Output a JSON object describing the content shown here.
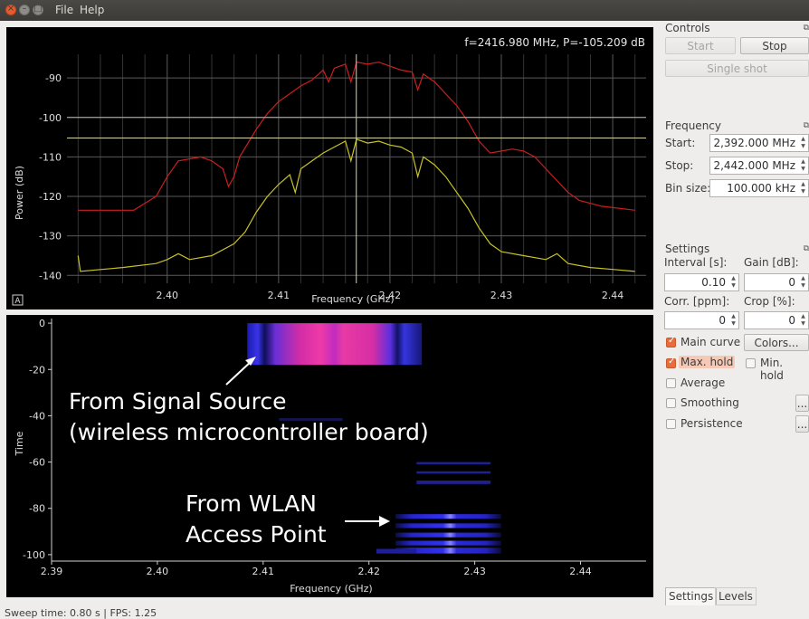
{
  "menu": {
    "file": "File",
    "help": "Help"
  },
  "spectrum": {
    "readout": "f=2416.980 MHz, P=-105.209 dB",
    "xlabel": "Frequency (GHz)",
    "ylabel": "Power (dB)",
    "x_ticks": [
      "2.40",
      "2.41",
      "2.42",
      "2.43",
      "2.44"
    ],
    "y_ticks": [
      "-90",
      "-100",
      "-110",
      "-120",
      "-130",
      "-140"
    ],
    "autoscale": "A"
  },
  "waterfall": {
    "xlabel": "Frequency (GHz)",
    "ylabel": "Time",
    "x_ticks": [
      "2.39",
      "2.40",
      "2.41",
      "2.42",
      "2.43",
      "2.44"
    ],
    "y_ticks": [
      "0",
      "-20",
      "-40",
      "-60",
      "-80",
      "-100"
    ],
    "annotation1": [
      "From Signal Source",
      "(wireless microcontroller board)"
    ],
    "annotation2": [
      "From WLAN",
      "Access Point"
    ]
  },
  "controls": {
    "title": "Controls",
    "start": "Start",
    "stop": "Stop",
    "single_shot": "Single shot"
  },
  "frequency": {
    "title": "Frequency",
    "start_label": "Start:",
    "start_value": "2,392.000 MHz",
    "stop_label": "Stop:",
    "stop_value": "2,442.000 MHz",
    "bin_label": "Bin size:",
    "bin_value": "100.000 kHz"
  },
  "settings": {
    "title": "Settings",
    "interval_label": "Interval [s]:",
    "interval_value": "0.10",
    "gain_label": "Gain [dB]:",
    "gain_value": "0",
    "corr_label": "Corr. [ppm]:",
    "corr_value": "0",
    "crop_label": "Crop [%]:",
    "crop_value": "0",
    "main_curve": "Main curve",
    "main_curve_checked": true,
    "colors_button": "Colors...",
    "max_hold": "Max. hold",
    "max_hold_checked": true,
    "min_hold": "Min. hold",
    "min_hold_checked": false,
    "average": "Average",
    "smoothing": "Smoothing",
    "persistence": "Persistence",
    "more": "..."
  },
  "tabs": {
    "settings": "Settings",
    "levels": "Levels"
  },
  "status": "Sweep time: 0.80 s | FPS: 1.25",
  "chart_data": [
    {
      "type": "line",
      "xlabel": "Frequency (GHz)",
      "ylabel": "Power (dB)",
      "xlim": [
        2.391,
        2.443
      ],
      "ylim": [
        -142,
        -84
      ],
      "grid": true,
      "series": [
        {
          "color": "#cc1f1f",
          "points": [
            [
              2.392,
              -123.5
            ],
            [
              2.397,
              -123.5
            ],
            [
              2.399,
              -120
            ],
            [
              2.4,
              -115
            ],
            [
              2.401,
              -111
            ],
            [
              2.403,
              -110
            ],
            [
              2.404,
              -111
            ],
            [
              2.405,
              -113
            ],
            [
              2.4055,
              -117.5
            ],
            [
              2.406,
              -115
            ],
            [
              2.4065,
              -110
            ],
            [
              2.408,
              -103
            ],
            [
              2.409,
              -99
            ],
            [
              2.41,
              -96
            ],
            [
              2.411,
              -94
            ],
            [
              2.412,
              -92
            ],
            [
              2.413,
              -90.5
            ],
            [
              2.414,
              -88
            ],
            [
              2.4145,
              -91
            ],
            [
              2.415,
              -87.5
            ],
            [
              2.416,
              -86.5
            ],
            [
              2.4165,
              -91
            ],
            [
              2.417,
              -86
            ],
            [
              2.418,
              -86.5
            ],
            [
              2.419,
              -86
            ],
            [
              2.42,
              -87
            ],
            [
              2.421,
              -88
            ],
            [
              2.422,
              -88.5
            ],
            [
              2.4225,
              -93
            ],
            [
              2.423,
              -89
            ],
            [
              2.424,
              -91
            ],
            [
              2.425,
              -94
            ],
            [
              2.426,
              -97
            ],
            [
              2.427,
              -101
            ],
            [
              2.428,
              -106
            ],
            [
              2.429,
              -109
            ],
            [
              2.43,
              -108.5
            ],
            [
              2.431,
              -108
            ],
            [
              2.432,
              -108.5
            ],
            [
              2.433,
              -110
            ],
            [
              2.434,
              -113
            ],
            [
              2.435,
              -116
            ],
            [
              2.436,
              -119
            ],
            [
              2.437,
              -121
            ],
            [
              2.439,
              -122.5
            ],
            [
              2.442,
              -123.5
            ]
          ]
        },
        {
          "color": "#c8c227",
          "points": [
            [
              2.392,
              -135
            ],
            [
              2.3922,
              -139
            ],
            [
              2.396,
              -138
            ],
            [
              2.399,
              -137
            ],
            [
              2.4,
              -136
            ],
            [
              2.401,
              -134.5
            ],
            [
              2.402,
              -136
            ],
            [
              2.404,
              -135
            ],
            [
              2.406,
              -132
            ],
            [
              2.407,
              -129
            ],
            [
              2.408,
              -124
            ],
            [
              2.409,
              -120
            ],
            [
              2.41,
              -117
            ],
            [
              2.411,
              -114.5
            ],
            [
              2.4115,
              -119
            ],
            [
              2.412,
              -113
            ],
            [
              2.413,
              -111
            ],
            [
              2.414,
              -109
            ],
            [
              2.415,
              -107.5
            ],
            [
              2.416,
              -106
            ],
            [
              2.4165,
              -111
            ],
            [
              2.417,
              -105.5
            ],
            [
              2.418,
              -106.5
            ],
            [
              2.419,
              -106
            ],
            [
              2.42,
              -107
            ],
            [
              2.421,
              -107.5
            ],
            [
              2.422,
              -109
            ],
            [
              2.4225,
              -115
            ],
            [
              2.423,
              -110
            ],
            [
              2.424,
              -112
            ],
            [
              2.425,
              -115
            ],
            [
              2.426,
              -119
            ],
            [
              2.427,
              -123
            ],
            [
              2.428,
              -128
            ],
            [
              2.429,
              -132
            ],
            [
              2.43,
              -134
            ],
            [
              2.432,
              -135
            ],
            [
              2.434,
              -136
            ],
            [
              2.435,
              -134.5
            ],
            [
              2.436,
              -137
            ],
            [
              2.438,
              -138
            ],
            [
              2.44,
              -138.5
            ],
            [
              2.442,
              -139
            ]
          ]
        }
      ]
    },
    {
      "type": "heatmap",
      "xlabel": "Frequency (GHz)",
      "ylabel": "Time",
      "xlim": [
        2.39,
        2.4462
      ],
      "ylim": [
        -102,
        2
      ],
      "bands": [
        {
          "x0": 2.4085,
          "x1": 2.425,
          "y0": 0,
          "y1": -18,
          "color": "#e0309a"
        },
        {
          "x0": 2.4225,
          "x1": 2.4325,
          "y0": -82,
          "y1": -100,
          "color": "#2a2adc"
        },
        {
          "x0": 2.4245,
          "x1": 2.4315,
          "y0": -60,
          "y1": -70,
          "color": "#1d1d8a"
        }
      ]
    }
  ]
}
